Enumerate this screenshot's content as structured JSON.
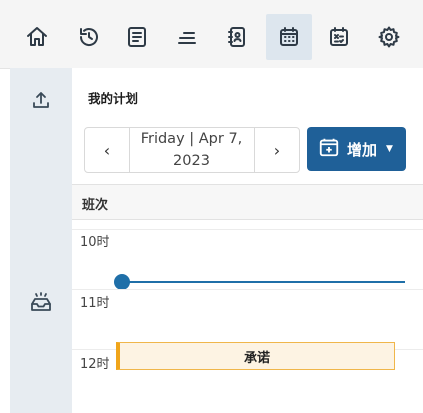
{
  "toolbar": {
    "buttons": [
      {
        "icon": "home-icon"
      },
      {
        "icon": "history-icon"
      },
      {
        "icon": "document-icon"
      },
      {
        "icon": "list-icon"
      },
      {
        "icon": "contacts-icon"
      },
      {
        "icon": "calendar-icon",
        "active": true
      },
      {
        "icon": "schedule-icon"
      },
      {
        "icon": "gear-icon"
      }
    ]
  },
  "sidebar": {
    "items": [
      {
        "icon": "upload-icon"
      },
      {
        "icon": "inbox-icon"
      }
    ]
  },
  "main": {
    "title": "我的计划",
    "date_line1": "Friday | Apr 7,",
    "date_line2": "2023",
    "add_button": "增加",
    "column_header": "班次",
    "hours": [
      "10时",
      "11时",
      "12时"
    ],
    "event_label": "承诺"
  },
  "colors": {
    "accent": "#1f6098",
    "now_line": "#1f6fa8",
    "event_border": "#f0a51a",
    "event_bg": "#fdf3e3"
  }
}
